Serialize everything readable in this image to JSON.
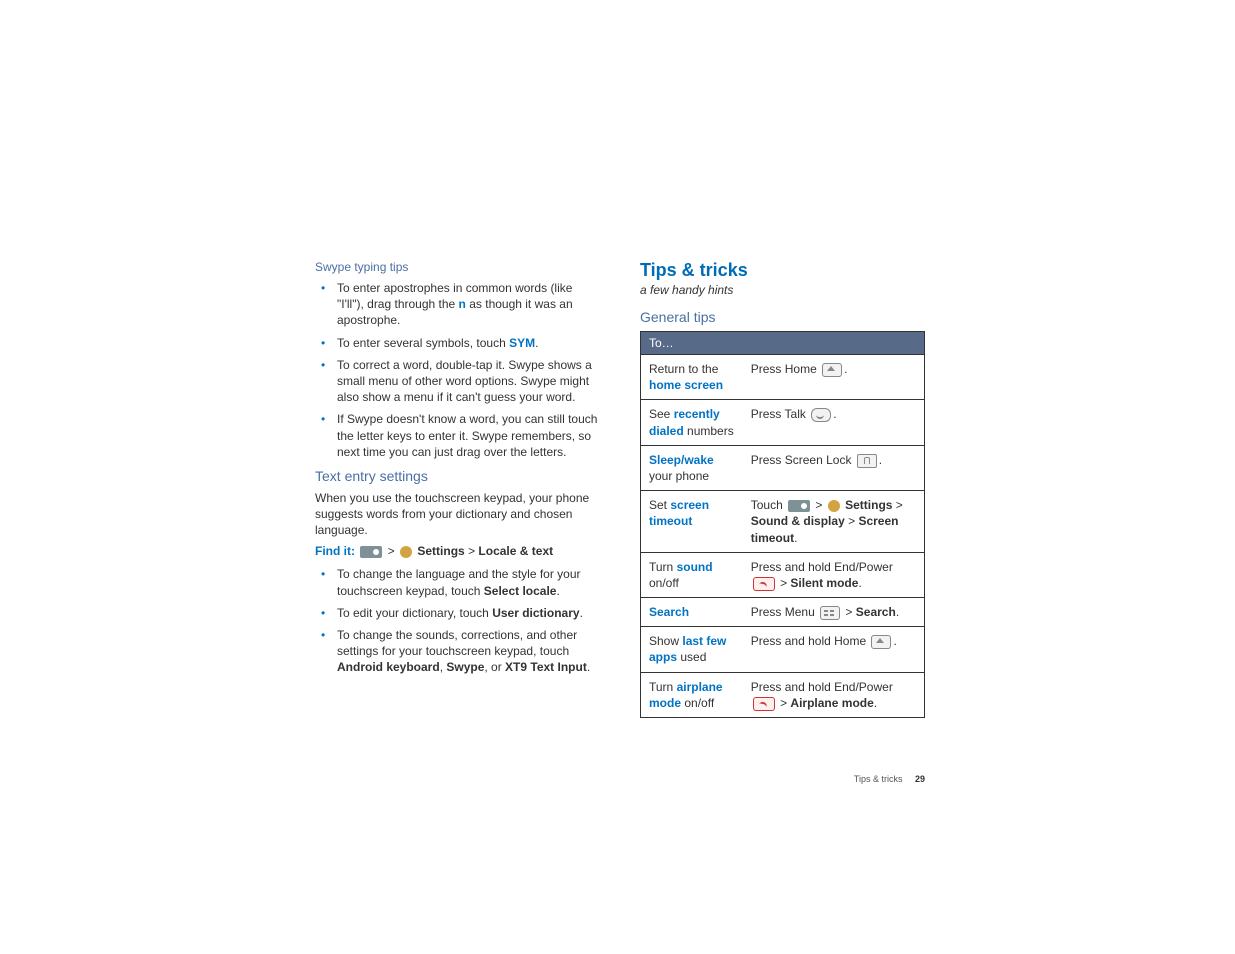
{
  "left": {
    "swype_heading": "Swype typing tips",
    "swype_bullets": {
      "b1_a": "To enter apostrophes in common words (like \"I'll\"), drag through the ",
      "b1_n": "n",
      "b1_b": " as though it was an apostrophe.",
      "b2_a": "To enter several symbols, touch ",
      "b2_sym": "SYM",
      "b2_b": ".",
      "b3": "To correct a word, double-tap it. Swype shows a small menu of other word options. Swype might also show a menu if it can't guess your word.",
      "b4": "If Swype doesn't know a word, you can still touch the letter keys to enter it. Swype remembers, so next time you can just drag over the letters."
    },
    "text_entry_heading": "Text entry settings",
    "text_entry_para": "When you use the touchscreen keypad, your phone suggests words from your dictionary and chosen language.",
    "findit_label": "Find it:",
    "findit_settings": "Settings",
    "findit_locale": "Locale & text",
    "gt": ">",
    "settings_bullets": {
      "b1_a": "To change the language and the style for your touchscreen keypad, touch ",
      "b1_b": "Select locale",
      "b1_c": ".",
      "b2_a": "To edit your dictionary, touch ",
      "b2_b": "User dictionary",
      "b2_c": ".",
      "b3_a": "To change the sounds, corrections, and other settings for your touchscreen keypad, touch ",
      "b3_b": "Android keyboard",
      "b3_c": ", ",
      "b3_d": "Swype",
      "b3_e": ", or ",
      "b3_f": "XT9 Text Input",
      "b3_g": "."
    }
  },
  "right": {
    "section_title": "Tips & tricks",
    "subtitle": "a few handy hints",
    "general_heading": "General tips",
    "table_header": "To…",
    "rows": [
      {
        "left_plain_a": "Return to the ",
        "left_link": "home screen",
        "left_plain_b": "",
        "right_a": "Press Home ",
        "icon": "home",
        "right_b": ".",
        "right_bold_a": "",
        "right_c": "",
        "right_bold_b": "",
        "right_d": ""
      },
      {
        "left_plain_a": "See ",
        "left_link": "recently dialed",
        "left_plain_b": " numbers",
        "right_a": "Press Talk ",
        "icon": "talk",
        "right_b": ".",
        "right_bold_a": "",
        "right_c": "",
        "right_bold_b": "",
        "right_d": ""
      },
      {
        "left_plain_a": "",
        "left_link": "Sleep/wake",
        "left_plain_b": " your phone",
        "right_a": "Press Screen Lock ",
        "icon": "lock",
        "right_b": ".",
        "right_bold_a": "",
        "right_c": "",
        "right_bold_b": "",
        "right_d": ""
      },
      {
        "left_plain_a": "Set ",
        "left_link": "screen timeout",
        "left_plain_b": "",
        "right_a": "Touch ",
        "icon": "launcher-gear",
        "right_b": " ",
        "right_bold_a": "Settings",
        "right_c": " > ",
        "right_bold_b": "Sound & display",
        "right_d": " > ",
        "right_bold_c": "Screen timeout",
        "right_e": "."
      },
      {
        "left_plain_a": "Turn ",
        "left_link": "sound",
        "left_plain_b": " on/off",
        "right_a": "Press and hold End/Power ",
        "icon": "power",
        "right_b": " > ",
        "right_bold_a": "Silent mode",
        "right_c": ".",
        "right_bold_b": "",
        "right_d": ""
      },
      {
        "left_plain_a": "",
        "left_link": "Search",
        "left_plain_b": "",
        "right_a": "Press Menu ",
        "icon": "menu",
        "right_b": " > ",
        "right_bold_a": "Search",
        "right_c": ".",
        "right_bold_b": "",
        "right_d": ""
      },
      {
        "left_plain_a": "Show ",
        "left_link": "last few apps",
        "left_plain_b": " used",
        "right_a": "Press and hold Home ",
        "icon": "home",
        "right_b": ".",
        "right_bold_a": "",
        "right_c": "",
        "right_bold_b": "",
        "right_d": ""
      },
      {
        "left_plain_a": "Turn ",
        "left_link": "airplane mode",
        "left_plain_b": " on/off",
        "right_a": "Press and hold End/Power ",
        "icon": "power",
        "right_b": " > ",
        "right_bold_a": "Airplane mode",
        "right_c": ".",
        "right_bold_b": "",
        "right_d": ""
      }
    ]
  },
  "footer": {
    "section": "Tips & tricks",
    "page": "29"
  }
}
